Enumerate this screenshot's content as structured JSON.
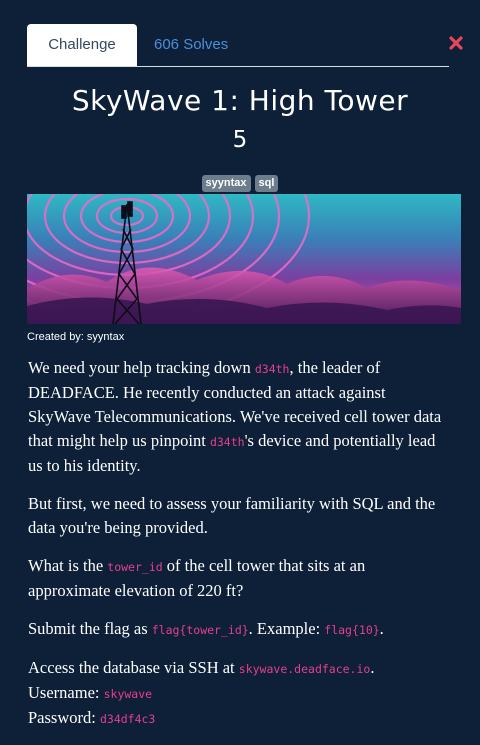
{
  "tabs": {
    "challenge": "Challenge",
    "solves": "606 Solves"
  },
  "challenge": {
    "title": "SkyWave 1: High Tower",
    "points": "5",
    "tags": [
      "syyntax",
      "sql"
    ],
    "created_by": "Created by: syyntax"
  },
  "description": {
    "p1": {
      "a": "We need your help tracking down ",
      "code1": "d34th",
      "b": ", the leader of DEADFACE. He recently conducted an attack against SkyWave Telecommunications. We've received cell tower data that might help us pinpoint ",
      "code2": "d34th",
      "c": "'s device and potentially lead us to his identity."
    },
    "p2": "But first, we need to assess your familiarity with SQL and the data you're being provided.",
    "p3": {
      "a": "What is the ",
      "code": "tower_id",
      "b": " of the cell tower that sits at an approximate elevation of 220 ft?"
    },
    "p4": {
      "a": "Submit the flag as ",
      "code1": "flag{tower_id}",
      "b": ". Example: ",
      "code2": "flag{10}",
      "c": "."
    },
    "p5": {
      "a": "Access the database via SSH at ",
      "host": "skywave.deadface.io",
      "b": ".",
      "user_label": "Username: ",
      "user": "skywave",
      "pass_label": "Password: ",
      "pass": "d34df4c3"
    }
  },
  "icons": {
    "close": "close-icon"
  },
  "colors": {
    "background": "#0d2038",
    "code": "#e83e8c",
    "tab_link": "#4a8fd8",
    "close": "#e8455b"
  }
}
